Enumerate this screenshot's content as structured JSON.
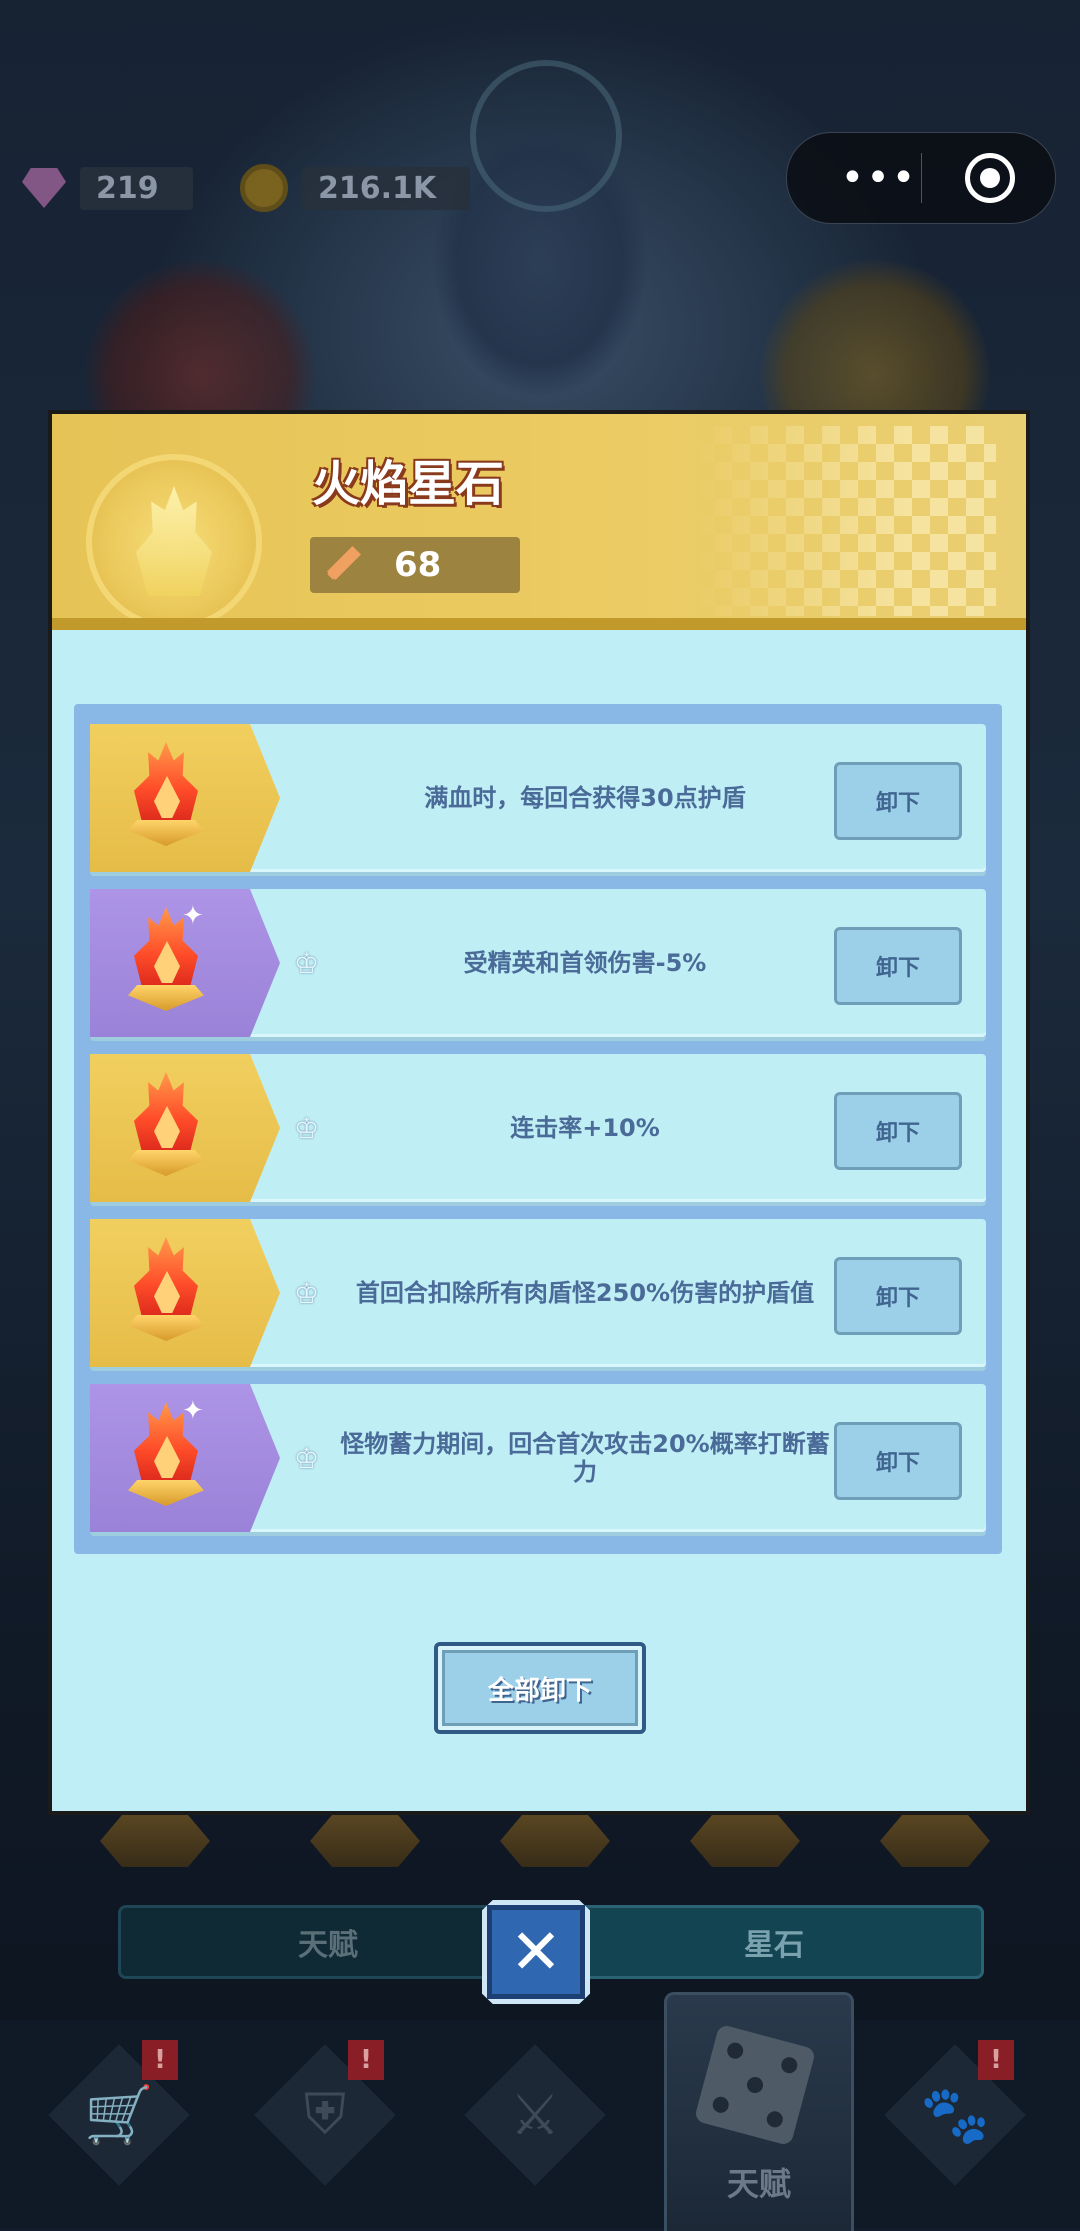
{
  "resources": {
    "gems": "219",
    "coins": "216.1K"
  },
  "modal": {
    "title": "火焰星石",
    "power": "68",
    "rows": [
      {
        "text": "满血时，每回合获得30点护盾",
        "tier": "gold",
        "starred": false,
        "button": "卸下"
      },
      {
        "text": "受精英和首领伤害-5%",
        "tier": "purple",
        "starred": true,
        "button": "卸下"
      },
      {
        "text": "连击率+10%",
        "tier": "gold",
        "starred": true,
        "button": "卸下"
      },
      {
        "text": "首回合扣除所有肉盾怪250%伤害的护盾值",
        "tier": "gold",
        "starred": true,
        "button": "卸下"
      },
      {
        "text": "怪物蓄力期间，回合首次攻击20%概率打断蓄力",
        "tier": "purple",
        "starred": true,
        "button": "卸下"
      }
    ],
    "unload_all": "全部卸下"
  },
  "segmented": {
    "left": "天赋",
    "right": "星石"
  },
  "tabbar": {
    "active_label": "天赋",
    "alert_mark": "!"
  },
  "icons": {
    "close": "close-icon",
    "menu": "more-dots-icon",
    "target": "target-icon",
    "shop": "cart-icon",
    "armor": "armor-icon",
    "battle": "crossed-swords-icon",
    "talent": "dice-icon",
    "pet": "paw-icon",
    "star": "star-icon",
    "sword": "sword-icon"
  },
  "colors": {
    "header_gold": "#ebcb62",
    "body_cyan": "#bfeef6",
    "row_text": "#4a6a98",
    "purple_tier": "#a48ce0",
    "gold_tier": "#ebc552",
    "close_blue": "#2f67b0"
  }
}
